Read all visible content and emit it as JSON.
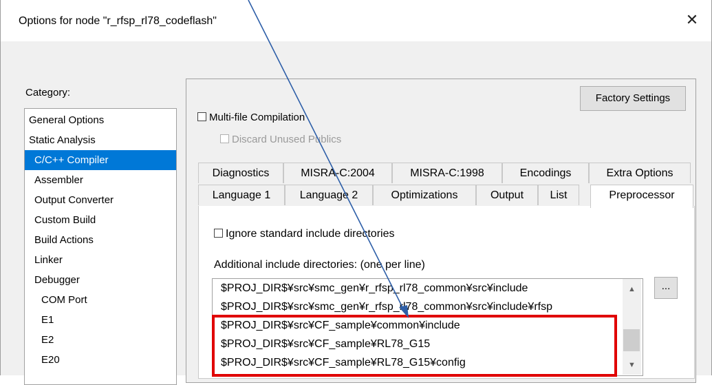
{
  "window": {
    "title": "Options for node \"r_rfsp_rl78_codeflash\"",
    "close_glyph": "✕"
  },
  "category": {
    "label": "Category:",
    "items": [
      "General Options",
      "Static Analysis",
      "C/C++ Compiler",
      "Assembler",
      "Output Converter",
      "Custom Build",
      "Build Actions",
      "Linker",
      "Debugger",
      "COM Port",
      "E1",
      "E2",
      "E20"
    ],
    "selected": "C/C++ Compiler"
  },
  "factory_settings": "Factory Settings",
  "multi_file": {
    "label": "Multi-file Compilation",
    "discard_label": "Discard Unused Publics"
  },
  "tabs": {
    "row1": [
      "Diagnostics",
      "MISRA-C:2004",
      "MISRA-C:1998",
      "Encodings",
      "Extra Options"
    ],
    "row2": [
      "Language 1",
      "Language 2",
      "Optimizations",
      "Output",
      "List",
      "Preprocessor"
    ],
    "active": "Preprocessor"
  },
  "preprocessor": {
    "ignore_label": "Ignore standard include directories",
    "additional_label": "Additional include directories: (one per line)",
    "browse_label": "...",
    "include_dirs": [
      "$PROJ_DIR$¥src¥smc_gen¥r_rfsp_rl78_common¥src¥include",
      "$PROJ_DIR$¥src¥smc_gen¥r_rfsp_rl78_common¥src¥include¥rfsp",
      "$PROJ_DIR$¥src¥CF_sample¥common¥include",
      "$PROJ_DIR$¥src¥CF_sample¥RL78_G15",
      "$PROJ_DIR$¥src¥CF_sample¥RL78_G15¥config"
    ]
  },
  "annotation": {
    "highlight_color": "#e00000",
    "arrow_color": "#2e5fa8"
  }
}
